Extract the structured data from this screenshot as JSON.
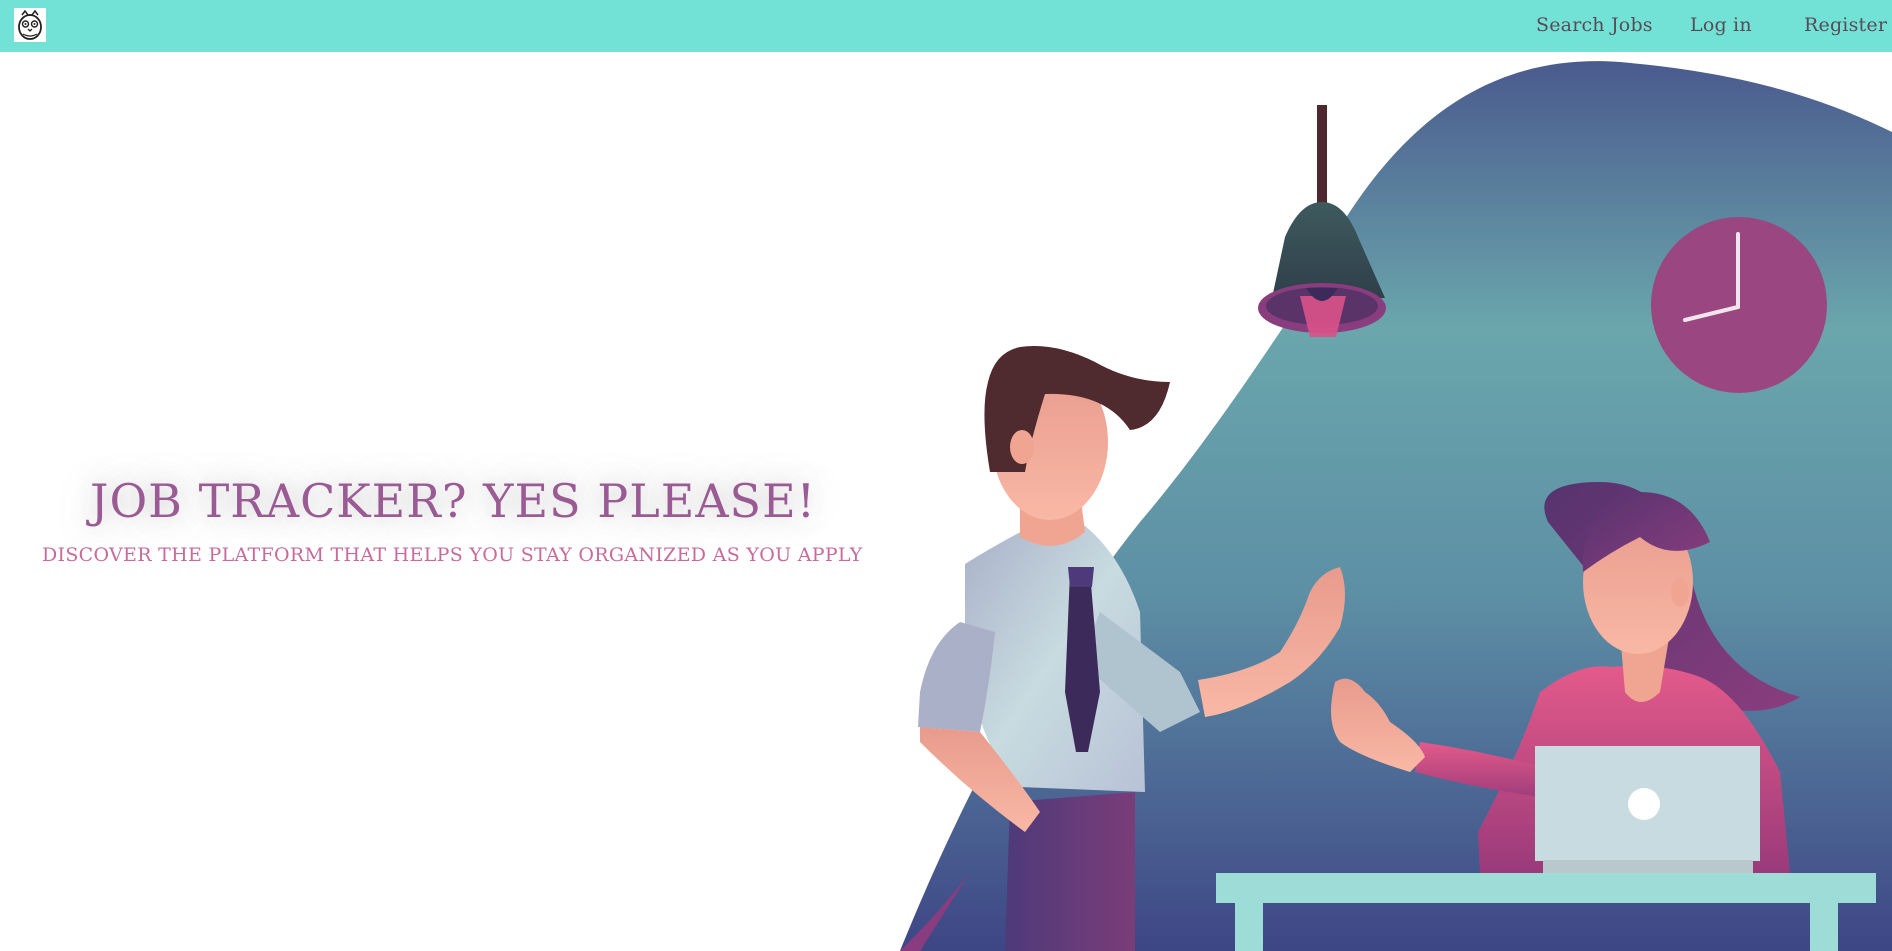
{
  "nav": {
    "logo_icon": "owl-logo-icon",
    "links": [
      {
        "label": "Search Jobs"
      },
      {
        "label": "Log in"
      },
      {
        "label": "Register"
      }
    ]
  },
  "hero": {
    "title": "JOB TRACKER? YES PLEASE!",
    "subtitle": "DISCOVER THE PLATFORM THAT HELPS YOU STAY ORGANIZED AS YOU APPLY"
  },
  "colors": {
    "navbar": "#72e2d6",
    "title": "#9a5a94",
    "subtitle": "#c86a9a",
    "nav_text": "#5a4a58"
  }
}
